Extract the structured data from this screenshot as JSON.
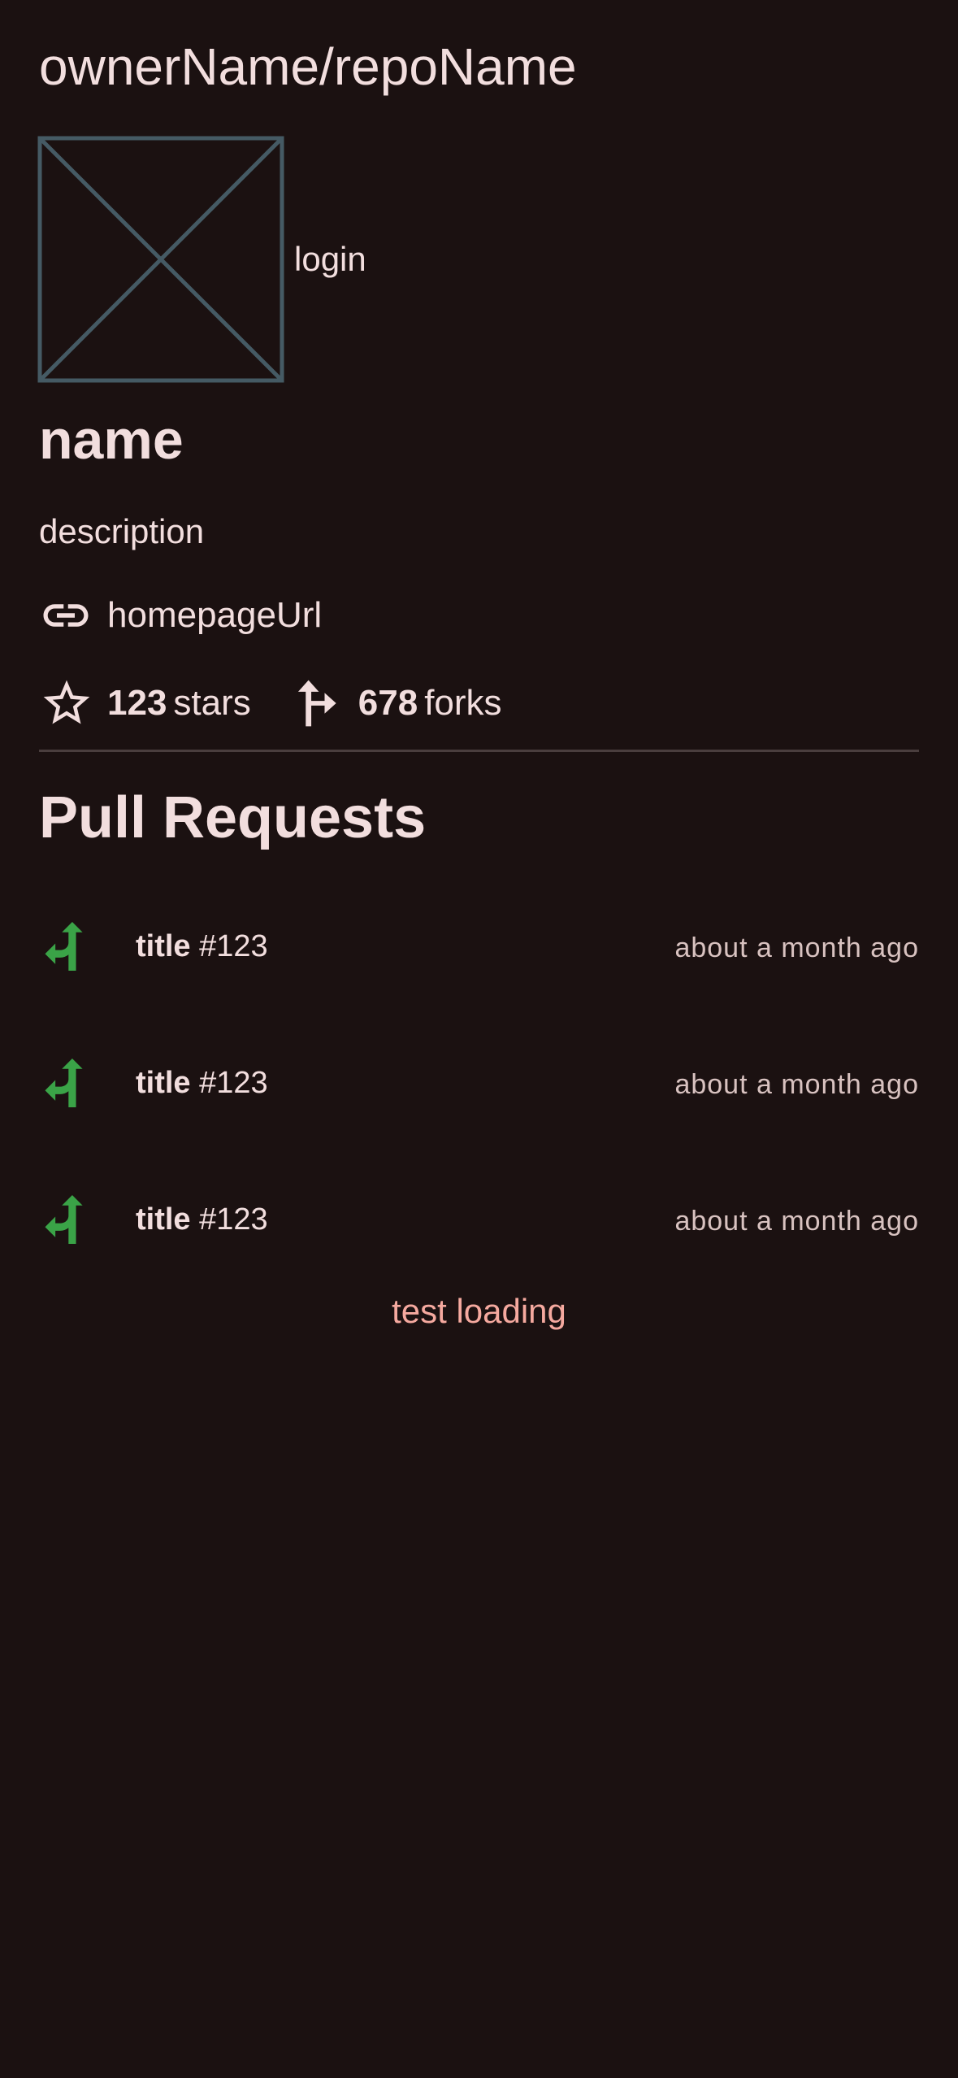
{
  "repo": {
    "full_name": "ownerName/repoName",
    "owner_login": "login",
    "name": "name",
    "description": "description",
    "homepage": "homepageUrl",
    "stars_count": "123",
    "stars_label": "stars",
    "forks_count": "678",
    "forks_label": "forks"
  },
  "section": {
    "title": "Pull Requests"
  },
  "pull_requests": [
    {
      "title": "title",
      "number": "#123",
      "time": "about a month ago"
    },
    {
      "title": "title",
      "number": "#123",
      "time": "about a month ago"
    },
    {
      "title": "title",
      "number": "#123",
      "time": "about a month ago"
    }
  ],
  "loading_text": "test loading",
  "colors": {
    "background": "#1b1111",
    "text": "#f2dede",
    "pr_icon": "#3aa347",
    "loading": "#f5a99f",
    "avatar_placeholder": "#455a64"
  },
  "icons": {
    "avatar": "image-placeholder-icon",
    "homepage": "link-icon",
    "stars": "star-outline-icon",
    "forks": "fork-icon",
    "pull_request": "pull-request-merge-icon"
  }
}
